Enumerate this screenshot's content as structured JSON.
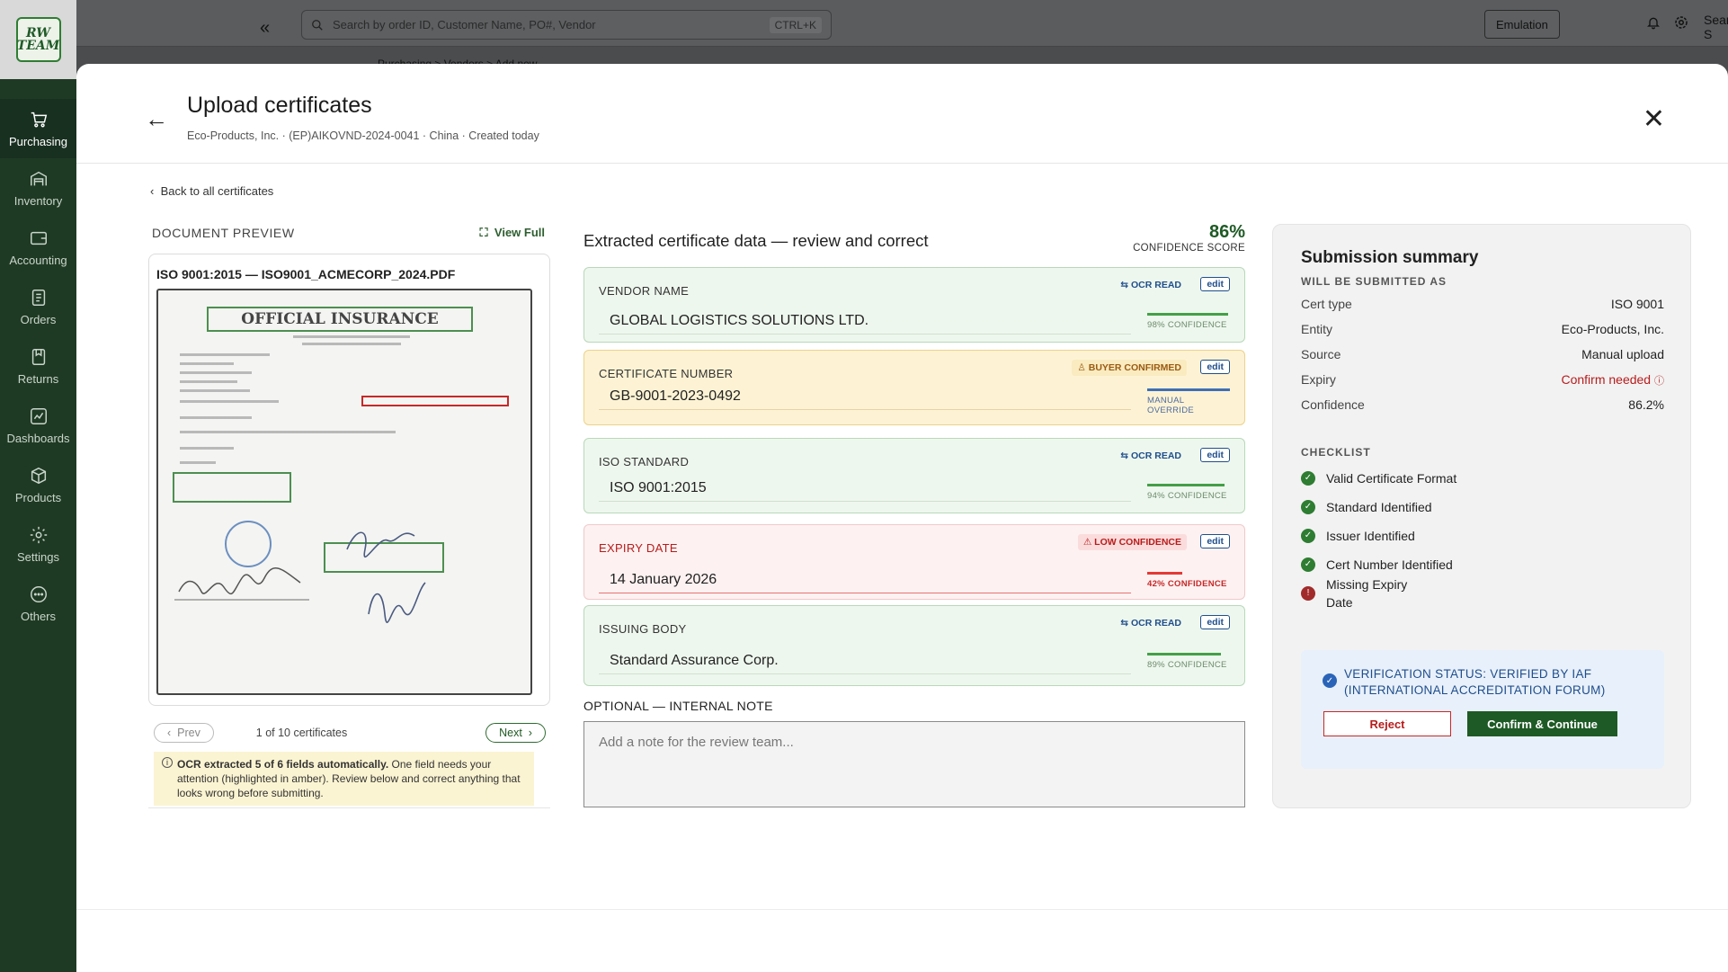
{
  "sidebar": {
    "logo_line1": "RW",
    "logo_line2": "TEAM",
    "items": [
      {
        "label": "Purchasing",
        "icon": "cart-icon"
      },
      {
        "label": "Inventory",
        "icon": "warehouse-icon"
      },
      {
        "label": "Accounting",
        "icon": "wallet-icon"
      },
      {
        "label": "Orders",
        "icon": "orders-icon"
      },
      {
        "label": "Returns",
        "icon": "returns-icon"
      },
      {
        "label": "Dashboards",
        "icon": "dashboard-icon"
      },
      {
        "label": "Products",
        "icon": "box-icon"
      },
      {
        "label": "Settings",
        "icon": "gear-icon"
      },
      {
        "label": "Others",
        "icon": "more-icon"
      }
    ]
  },
  "topbar": {
    "search_placeholder": "Search by order ID, Customer Name, PO#, Vendor",
    "search_shortcut": "CTRL+K",
    "emulation_label": "Emulation",
    "user_name": "Sean S",
    "user_initials": "SS",
    "breadcrumb": "Purchasing > Vendors > Add new"
  },
  "modal": {
    "title": "Upload certificates",
    "subtitle": "Eco-Products, Inc.  · (EP)AIKOVND-2024-0041 · China · Created today",
    "back_link": "Back to all certificates"
  },
  "preview": {
    "heading": "DOCUMENT PREVIEW",
    "view_full": "View Full",
    "file_name": "ISO 9001:2015 — ISO9001_ACMECORP_2024.PDF",
    "doc_banner": "OFFICIAL INSURANCE",
    "prev_label": "Prev",
    "next_label": "Next",
    "page_info": "1 of 10 certificates",
    "ocr_note_bold": "OCR extracted 5 of 6 fields automatically.",
    "ocr_note_rest": " One field needs your attention (highlighted in amber). Review below and correct anything that looks wrong before submitting."
  },
  "extracted": {
    "title": "Extracted certificate data — review and correct",
    "score": "86%",
    "score_label": "CONFIDENCE SCORE",
    "fields": [
      {
        "label": "VENDOR NAME",
        "value": "GLOBAL LOGISTICS SOLUTIONS LTD.",
        "tag": "OCR READ",
        "edit": "edit",
        "confidence": "98% CONFIDENCE",
        "confidence_pct": 98
      },
      {
        "label": "CERTIFICATE NUMBER",
        "value": "GB-9001-2023-0492",
        "tag": "BUYER CONFIRMED",
        "edit": "edit",
        "confidence": "MANUAL OVERRIDE",
        "confidence_pct": 100
      },
      {
        "label": "ISO STANDARD",
        "value": "ISO 9001:2015",
        "tag": "OCR READ",
        "edit": "edit",
        "confidence": "94% CONFIDENCE",
        "confidence_pct": 94
      },
      {
        "label": "EXPIRY DATE",
        "value": "14 January 2026",
        "tag": "LOW CONFIDENCE",
        "edit": "edit",
        "confidence": "42% CONFIDENCE",
        "confidence_pct": 42
      },
      {
        "label": "ISSUING BODY",
        "value": "Standard Assurance Corp.",
        "tag": "OCR READ",
        "edit": "edit",
        "confidence": "89% CONFIDENCE",
        "confidence_pct": 89
      }
    ],
    "note_label": "OPTIONAL — INTERNAL NOTE",
    "note_placeholder": "Add a note for the review team..."
  },
  "summary": {
    "title": "Submission summary",
    "subtitle": "WILL BE SUBMITTED AS",
    "rows": [
      {
        "label": "Cert type",
        "value": "ISO 9001"
      },
      {
        "label": "Entity",
        "value": "Eco-Products, Inc."
      },
      {
        "label": "Source",
        "value": "Manual upload"
      },
      {
        "label": "Expiry",
        "value": "Confirm needed"
      },
      {
        "label": "Confidence",
        "value": "86.2%"
      }
    ],
    "checklist_title": "CHECKLIST",
    "checklist": [
      {
        "label": "Valid Certificate Format",
        "ok": true
      },
      {
        "label": "Standard Identified",
        "ok": true
      },
      {
        "label": "Issuer Identified",
        "ok": true
      },
      {
        "label": "Cert Number Identified",
        "ok": true
      },
      {
        "label": "Missing Expiry Date",
        "ok": false
      }
    ],
    "verification": "VERIFICATION STATUS: VERIFIED BY IAF (INTERNATIONAL ACCREDITATION FORUM)",
    "reject_label": "Reject",
    "confirm_label": "Confirm & Continue"
  },
  "colors": {
    "brand_green": "#1e5a25",
    "sidebar_bg": "#1f3a24",
    "ocr_bg": "#eef7ee",
    "amber_bg": "#fdf3d4",
    "error_red": "#b71c1c",
    "info_blue": "#1f4e8c"
  }
}
